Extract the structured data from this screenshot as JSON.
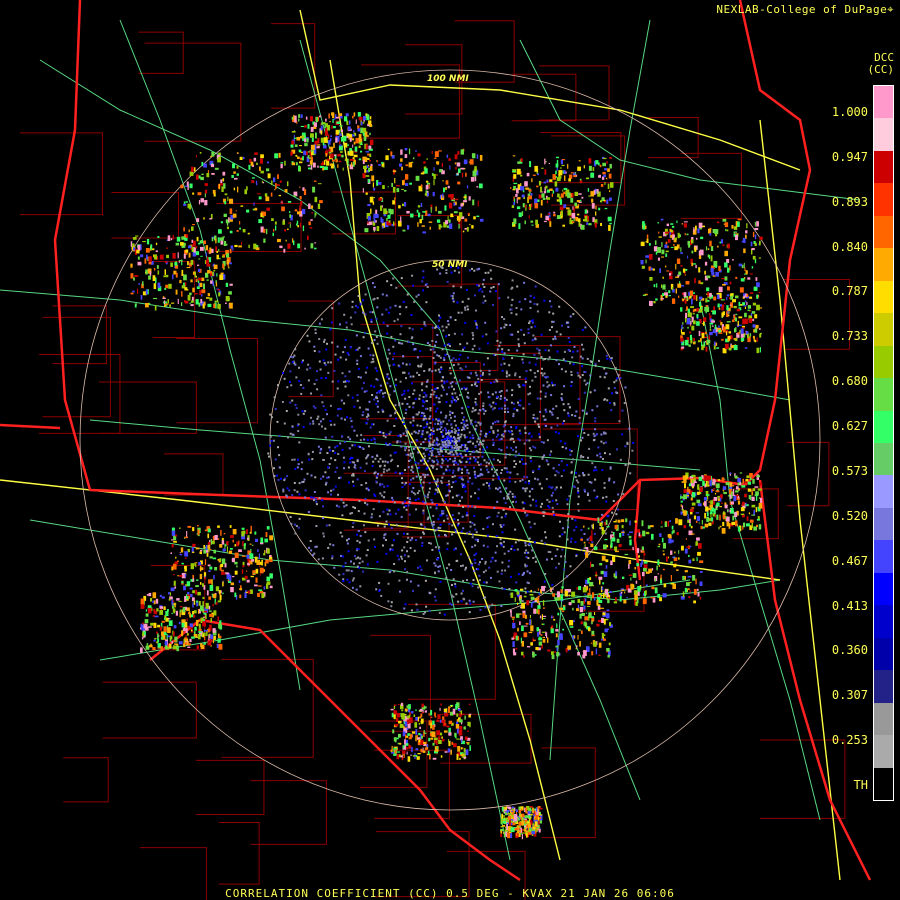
{
  "credit": "NEXLAB-College of DuPage",
  "credit_icon": "map-pin-icon",
  "product": {
    "code_label": "DCC",
    "unit_label": "(CC)"
  },
  "rings": [
    {
      "label": "100 NMI"
    },
    {
      "label": "50 NMI"
    }
  ],
  "scale": {
    "ticks": [
      "1.000",
      "0.947",
      "0.893",
      "0.840",
      "0.787",
      "0.733",
      "0.680",
      "0.627",
      "0.573",
      "0.520",
      "0.467",
      "0.413",
      "0.360",
      "0.307",
      "0.253",
      "TH"
    ],
    "colors": [
      "#ff99cc",
      "#ffccdd",
      "#cc0000",
      "#ff3300",
      "#ff6600",
      "#ffaa00",
      "#ffdd00",
      "#cccc00",
      "#99cc00",
      "#66dd44",
      "#33ff66",
      "#66cc66",
      "#9999ff",
      "#7777dd",
      "#4444ff",
      "#0000ff",
      "#0000cc",
      "#0000aa",
      "#222288",
      "#999999",
      "#aaaaaa",
      "#000000"
    ]
  },
  "footer": "CORRELATION COEFFICIENT (CC) 0.5 DEG - KVAX 21 JAN 26 06:06",
  "colors": {
    "text": "#ffff55",
    "state_border": "#ff2020",
    "county_border": "#aa0000",
    "highway": "#ffff44",
    "roads": "#66ff99",
    "ring": "#ddbbaa"
  }
}
